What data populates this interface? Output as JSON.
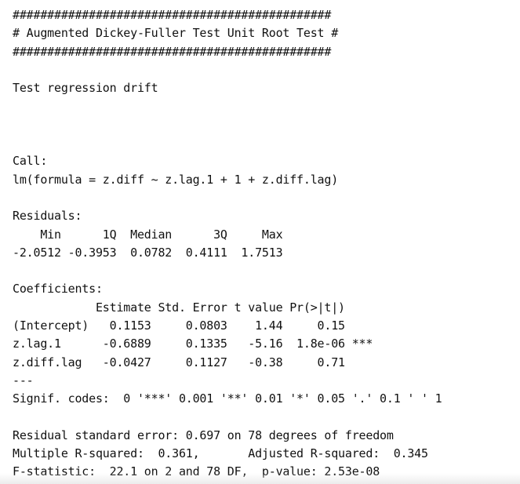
{
  "header": {
    "border_top": "##############################################",
    "title": "# Augmented Dickey-Fuller Test Unit Root Test #",
    "border_bottom": "##############################################"
  },
  "test_regression": "Test regression drift",
  "call": {
    "label": "Call:",
    "formula": "lm(formula = z.diff ~ z.lag.1 + 1 + z.diff.lag)"
  },
  "residuals": {
    "label": "Residuals:",
    "header_row": "    Min      1Q  Median      3Q     Max ",
    "values_row": "-2.0512 -0.3953  0.0782  0.4111  1.7513 "
  },
  "coefficients": {
    "label": "Coefficients:",
    "header_row": "            Estimate Std. Error t value Pr(>|t|)    ",
    "rows": [
      "(Intercept)   0.1153     0.0803    1.44     0.15    ",
      "z.lag.1      -0.6889     0.1335   -5.16  1.8e-06 ***",
      "z.diff.lag   -0.0427     0.1127   -0.38     0.71    "
    ],
    "separator": "---",
    "signif_codes": "Signif. codes:  0 '***' 0.001 '**' 0.01 '*' 0.05 '.' 0.1 ' ' 1"
  },
  "summary": {
    "residual_se": "Residual standard error: 0.697 on 78 degrees of freedom",
    "r_squared": "Multiple R-squared:  0.361,\tAdjusted R-squared:  0.345 ",
    "f_statistic": "F-statistic:  22.1 on 2 and 78 DF,  p-value: 2.53e-08"
  }
}
